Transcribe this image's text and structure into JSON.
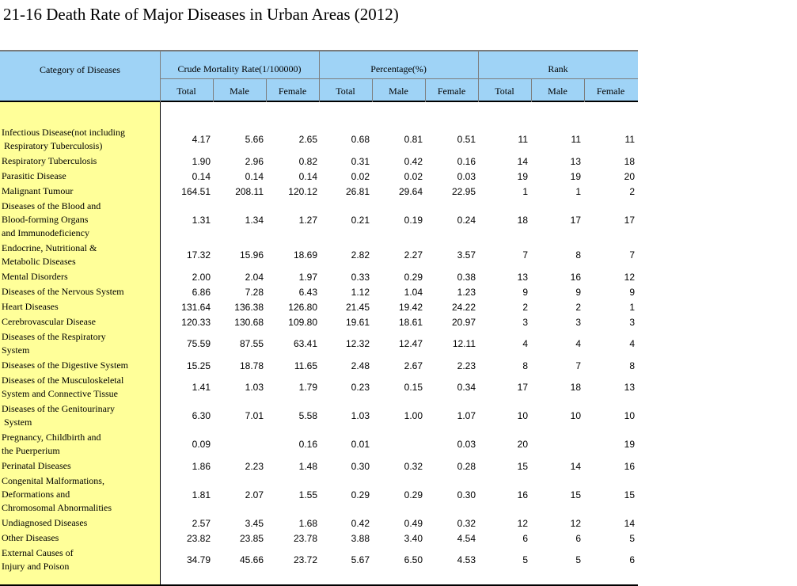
{
  "title": "21-16 Death Rate of Major Diseases in Urban Areas (2012)",
  "header": {
    "category": "Category of Diseases",
    "groups": [
      "Crude Mortality Rate(1/100000)",
      "Percentage(%)",
      "Rank"
    ],
    "sub": [
      "Total",
      "Male",
      "Female",
      "Total",
      "Male",
      "Female",
      "Total",
      "Male",
      "Female"
    ]
  },
  "colors": {
    "header_bg": "#9fd3f6",
    "category_bg": "#ffff99"
  },
  "rows": [
    {
      "category": "Infectious Disease(not including\n Respiratory Tuberculosis)",
      "values": [
        "4.17",
        "5.66",
        "2.65",
        "0.68",
        "0.81",
        "0.51",
        "11",
        "11",
        "11"
      ]
    },
    {
      "category": "Respiratory Tuberculosis",
      "values": [
        "1.90",
        "2.96",
        "0.82",
        "0.31",
        "0.42",
        "0.16",
        "14",
        "13",
        "18"
      ]
    },
    {
      "category": "Parasitic Disease",
      "values": [
        "0.14",
        "0.14",
        "0.14",
        "0.02",
        "0.02",
        "0.03",
        "19",
        "19",
        "20"
      ]
    },
    {
      "category": "Malignant Tumour",
      "values": [
        "164.51",
        "208.11",
        "120.12",
        "26.81",
        "29.64",
        "22.95",
        "1",
        "1",
        "2"
      ]
    },
    {
      "category": "Diseases of the Blood and\nBlood-forming Organs\nand Immunodeficiency",
      "values": [
        "1.31",
        "1.34",
        "1.27",
        "0.21",
        "0.19",
        "0.24",
        "18",
        "17",
        "17"
      ]
    },
    {
      "category": "Endocrine, Nutritional &\nMetabolic Diseases",
      "values": [
        "17.32",
        "15.96",
        "18.69",
        "2.82",
        "2.27",
        "3.57",
        "7",
        "8",
        "7"
      ]
    },
    {
      "category": "Mental Disorders",
      "values": [
        "2.00",
        "2.04",
        "1.97",
        "0.33",
        "0.29",
        "0.38",
        "13",
        "16",
        "12"
      ]
    },
    {
      "category": "Diseases of the Nervous System",
      "values": [
        "6.86",
        "7.28",
        "6.43",
        "1.12",
        "1.04",
        "1.23",
        "9",
        "9",
        "9"
      ]
    },
    {
      "category": "Heart Diseases",
      "values": [
        "131.64",
        "136.38",
        "126.80",
        "21.45",
        "19.42",
        "24.22",
        "2",
        "2",
        "1"
      ]
    },
    {
      "category": "Cerebrovascular Disease",
      "values": [
        "120.33",
        "130.68",
        "109.80",
        "19.61",
        "18.61",
        "20.97",
        "3",
        "3",
        "3"
      ]
    },
    {
      "category": "Diseases of the Respiratory\nSystem",
      "values": [
        "75.59",
        "87.55",
        "63.41",
        "12.32",
        "12.47",
        "12.11",
        "4",
        "4",
        "4"
      ]
    },
    {
      "category": "Diseases of the Digestive System",
      "values": [
        "15.25",
        "18.78",
        "11.65",
        "2.48",
        "2.67",
        "2.23",
        "8",
        "7",
        "8"
      ]
    },
    {
      "category": "Diseases of the Musculoskeletal\nSystem and Connective Tissue",
      "values": [
        "1.41",
        "1.03",
        "1.79",
        "0.23",
        "0.15",
        "0.34",
        "17",
        "18",
        "13"
      ]
    },
    {
      "category": "Diseases of the Genitourinary\n System",
      "values": [
        "6.30",
        "7.01",
        "5.58",
        "1.03",
        "1.00",
        "1.07",
        "10",
        "10",
        "10"
      ]
    },
    {
      "category": "Pregnancy, Childbirth and\nthe Puerperium",
      "values": [
        "0.09",
        "",
        "0.16",
        "0.01",
        "",
        "0.03",
        "20",
        "",
        "19"
      ]
    },
    {
      "category": "Perinatal Diseases",
      "values": [
        "1.86",
        "2.23",
        "1.48",
        "0.30",
        "0.32",
        "0.28",
        "15",
        "14",
        "16"
      ]
    },
    {
      "category": "Congenital Malformations,\nDeformations and\nChromosomal Abnormalities",
      "values": [
        "1.81",
        "2.07",
        "1.55",
        "0.29",
        "0.29",
        "0.30",
        "16",
        "15",
        "15"
      ]
    },
    {
      "category": "Undiagnosed Diseases",
      "values": [
        "2.57",
        "3.45",
        "1.68",
        "0.42",
        "0.49",
        "0.32",
        "12",
        "12",
        "14"
      ]
    },
    {
      "category": "Other Diseases",
      "values": [
        "23.82",
        "23.85",
        "23.78",
        "3.88",
        "3.40",
        "4.54",
        "6",
        "6",
        "5"
      ]
    },
    {
      "category": "External Causes of\nInjury and Poison",
      "values": [
        "34.79",
        "45.66",
        "23.72",
        "5.67",
        "6.50",
        "4.53",
        "5",
        "5",
        "6"
      ]
    }
  ]
}
